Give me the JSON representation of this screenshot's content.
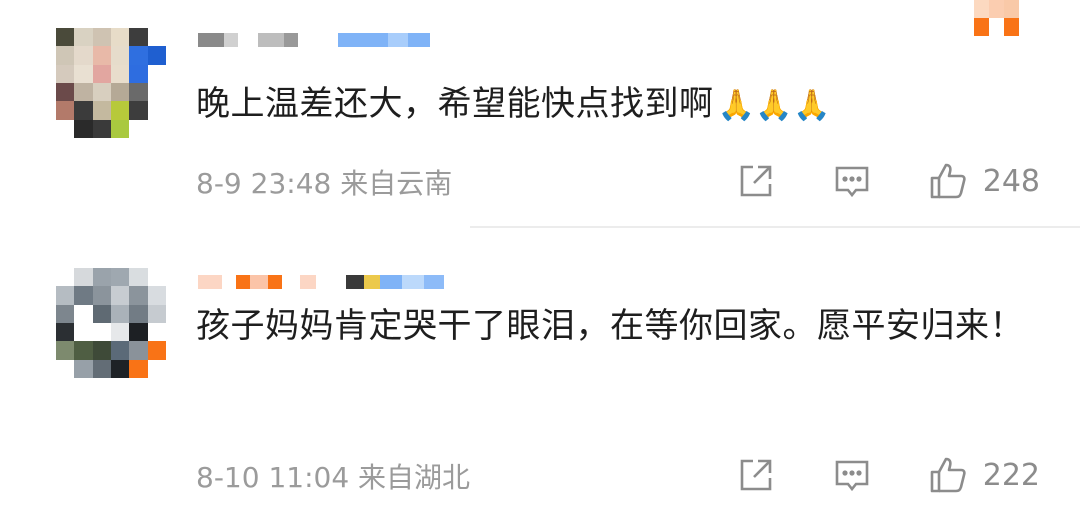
{
  "comments": [
    {
      "text": "晚上温差还大，希望能快点找到啊🙏🙏🙏",
      "text_main": "晚上温差还大，希望能快点找到啊",
      "emoji": "🙏🙏🙏",
      "time": "8-9 23:48",
      "location": "来自云南",
      "likes": "248",
      "icons": {
        "share": "share-icon",
        "comment": "comment-icon",
        "like": "thumbs-up-icon"
      }
    },
    {
      "text": "孩子妈妈肯定哭干了眼泪，在等你回家。愿平安归来！",
      "text_main": "孩子妈妈肯定哭干了眼泪，在等你回家。愿平安归来！",
      "time": "8-10 11:04",
      "location": "来自湖北",
      "likes": "222",
      "icons": {
        "share": "share-icon",
        "comment": "comment-icon",
        "like": "thumbs-up-icon"
      }
    }
  ],
  "colors": {
    "text": "#1e1e1e",
    "meta": "#9b9b9b",
    "icon": "#8c8c8c",
    "accent_orange": "#f97316",
    "accent_blue": "#60a5fa"
  }
}
